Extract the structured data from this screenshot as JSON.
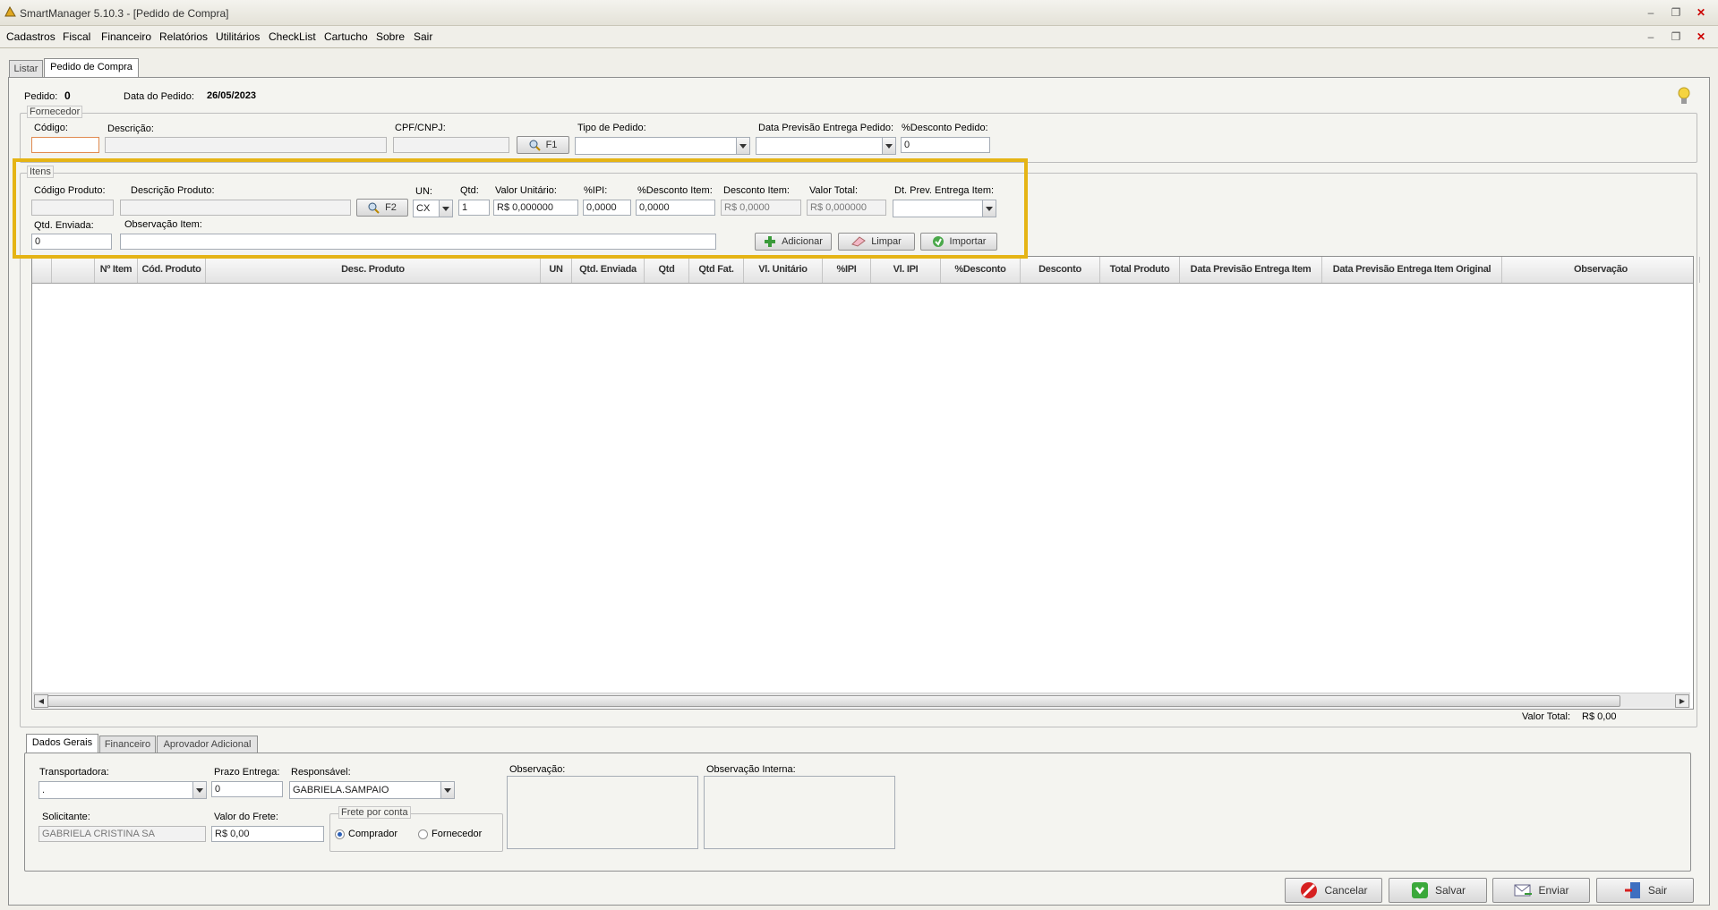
{
  "window": {
    "title": "SmartManager 5.10.3 - [Pedido de Compra]"
  },
  "menu": [
    "Cadastros",
    "Fiscal",
    "Financeiro",
    "Relatórios",
    "Utilitários",
    "CheckList",
    "Cartucho",
    "Sobre",
    "Sair"
  ],
  "tabs": {
    "list": "Listar",
    "active": "Pedido de Compra"
  },
  "header": {
    "pedido_label": "Pedido:",
    "pedido_value": "0",
    "data_label": "Data do Pedido:",
    "data_value": "26/05/2023"
  },
  "fornecedor": {
    "group": "Fornecedor",
    "codigo_label": "Código:",
    "codigo_value": "",
    "descricao_label": "Descrição:",
    "cpf_label": "CPF/CNPJ:",
    "search_btn": "F1",
    "tipo_label": "Tipo de Pedido:",
    "data_prev_label": "Data Previsão Entrega Pedido:",
    "desconto_label": "%Desconto Pedido:",
    "desconto_value": "0"
  },
  "itens": {
    "group": "Itens",
    "codigo_label": "Código Produto:",
    "descricao_label": "Descrição Produto:",
    "search_btn": "F2",
    "un_label": "UN:",
    "un_value": "CX",
    "qtd_label": "Qtd:",
    "qtd_value": "1",
    "valor_unit_label": "Valor Unitário:",
    "valor_unit_value": "R$ 0,000000",
    "ipi_label": "%IPI:",
    "ipi_value": "0,0000",
    "desc_item_pct_label": "%Desconto Item:",
    "desc_item_pct_value": "0,0000",
    "desc_item_label": "Desconto Item:",
    "desc_item_value": "R$ 0,0000",
    "valor_total_label": "Valor Total:",
    "valor_total_value": "R$ 0,000000",
    "dt_prev_label": "Dt. Prev. Entrega Item:",
    "qtd_enviada_label": "Qtd. Enviada:",
    "qtd_enviada_value": "0",
    "obs_label": "Observação Item:",
    "btn_add": "Adicionar",
    "btn_clear": "Limpar",
    "btn_import": "Importar"
  },
  "grid": {
    "columns": [
      "Nº Item",
      "Cód. Produto",
      "Desc. Produto",
      "UN",
      "Qtd. Enviada",
      "Qtd",
      "Qtd Fat.",
      "Vl. Unitário",
      "%IPI",
      "Vl. IPI",
      "%Desconto",
      "Desconto",
      "Total Produto",
      "Data Previsão Entrega Item",
      "Data Previsão Entrega Item Original",
      "Observação"
    ],
    "rows": []
  },
  "totals": {
    "label": "Valor Total:",
    "value": "R$ 0,00"
  },
  "bottom_tabs": [
    "Dados Gerais",
    "Financeiro",
    "Aprovador Adicional"
  ],
  "dados": {
    "transportadora_label": "Transportadora:",
    "transportadora_value": ".",
    "prazo_label": "Prazo Entrega:",
    "prazo_value": "0",
    "responsavel_label": "Responsável:",
    "responsavel_value": "GABRIELA.SAMPAIO",
    "obs_label": "Observação:",
    "obs_interna_label": "Observação Interna:",
    "solicitante_label": "Solicitante:",
    "solicitante_value": "GABRIELA CRISTINA SA",
    "frete_label": "Valor do Frete:",
    "frete_value": "R$ 0,00",
    "frete_group": "Frete por conta",
    "comprador": "Comprador",
    "fornecedor": "Fornecedor"
  },
  "actions": {
    "cancel": "Cancelar",
    "save": "Salvar",
    "send": "Enviar",
    "exit": "Sair"
  },
  "colors": {
    "highlight": "#e5b415"
  }
}
